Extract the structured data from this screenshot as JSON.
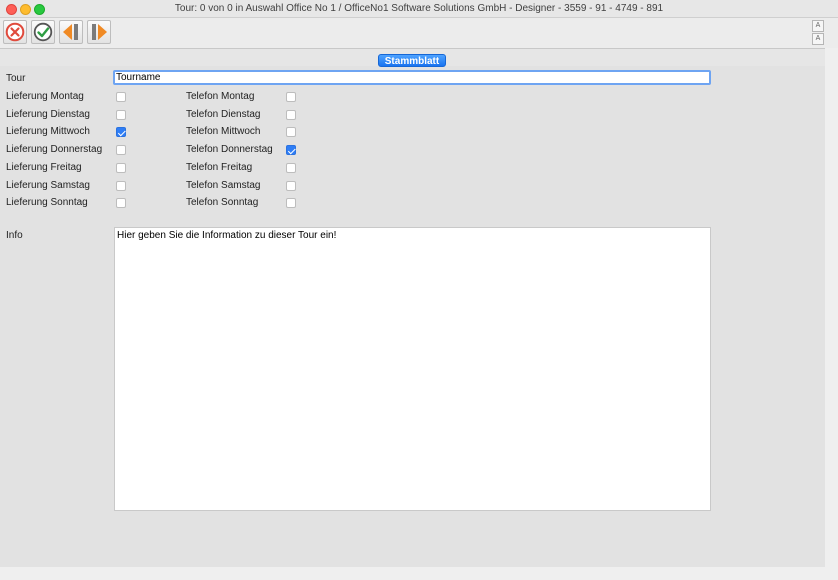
{
  "window": {
    "title": "Tour: 0 von 0 in Auswahl Office No 1 /  OfficeNo1 Software Solutions GmbH - Designer - 3559 - 91 - 4749 - 891"
  },
  "toolbar": {
    "buttons": [
      {
        "name": "cancel",
        "icon": "x-circle-icon"
      },
      {
        "name": "confirm",
        "icon": "check-circle-icon"
      },
      {
        "name": "previous",
        "icon": "arrow-left-icon"
      },
      {
        "name": "next",
        "icon": "arrow-right-icon"
      }
    ],
    "side_font_up": "A",
    "side_font_down": "A"
  },
  "tab": {
    "label": "Stammblatt"
  },
  "form": {
    "tour_label": "Tour",
    "tour_value": "Tourname",
    "delivery": [
      {
        "label": "Lieferung Montag",
        "checked": false
      },
      {
        "label": "Lieferung Dienstag",
        "checked": false
      },
      {
        "label": "Lieferung Mittwoch",
        "checked": true
      },
      {
        "label": "Lieferung Donnerstag",
        "checked": false
      },
      {
        "label": "Lieferung Freitag",
        "checked": false
      },
      {
        "label": "Lieferung Samstag",
        "checked": false
      },
      {
        "label": "Lieferung Sonntag",
        "checked": false
      }
    ],
    "phone": [
      {
        "label": "Telefon Montag",
        "checked": false
      },
      {
        "label": "Telefon Dienstag",
        "checked": false
      },
      {
        "label": "Telefon Mittwoch",
        "checked": false
      },
      {
        "label": "Telefon Donnerstag",
        "checked": true
      },
      {
        "label": "Telefon Freitag",
        "checked": false
      },
      {
        "label": "Telefon Samstag",
        "checked": false
      },
      {
        "label": "Telefon Sonntag",
        "checked": false
      }
    ],
    "info_label": "Info",
    "info_value": "Hier geben Sie die Information zu dieser Tour ein!"
  },
  "colors": {
    "accent": "#2f7ef6",
    "cancel_red": "#e0443e",
    "confirm_green": "#2f9e44",
    "nav_orange": "#f08a24"
  }
}
